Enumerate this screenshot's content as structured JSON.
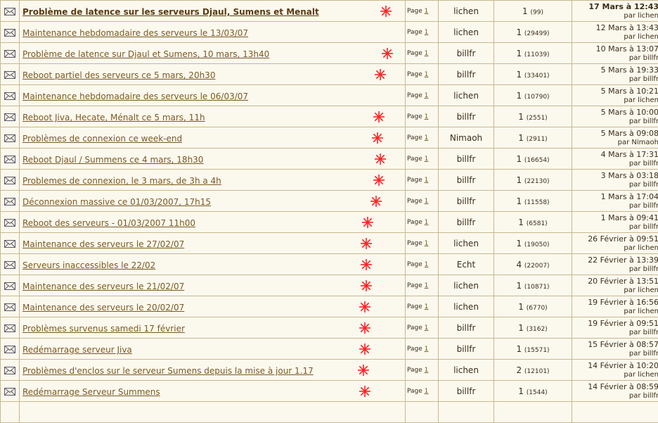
{
  "page_word": "Page",
  "topics": [
    {
      "title": "Problème de latence sur les serveurs Djaul, Sumens et Menalt",
      "page": "1",
      "author": "lichen",
      "replies": "1",
      "views": "(99)",
      "date": "17 Mars à 12:43",
      "by": "par lichen",
      "star": true
    },
    {
      "title": "Maintenance hebdomadaire des serveurs le 13/03/07",
      "page": "1",
      "author": "lichen",
      "replies": "1",
      "views": "(29499)",
      "date": "12 Mars à 13:43",
      "by": "par lichen",
      "star": false
    },
    {
      "title": "Problème de latence sur Djaul et Sumens, 10 mars, 13h40",
      "page": "1",
      "author": "billfr",
      "replies": "1",
      "views": "(11039)",
      "date": "10 Mars à 13:07",
      "by": "par billfr",
      "star": true
    },
    {
      "title": "Reboot partiel des serveurs ce 5 mars, 20h30",
      "page": "1",
      "author": "billfr",
      "replies": "1",
      "views": "(33401)",
      "date": "5 Mars à 19:33",
      "by": "par billfr",
      "star": true
    },
    {
      "title": "Maintenance hebdomadaire des serveurs le 06/03/07",
      "page": "1",
      "author": "lichen",
      "replies": "1",
      "views": "(10790)",
      "date": "5 Mars à 10:21",
      "by": "par lichen",
      "star": false
    },
    {
      "title": "Reboot Jiva, Hecate, Ménalt ce 5 mars, 11h",
      "page": "1",
      "author": "billfr",
      "replies": "1",
      "views": "(2551)",
      "date": "5 Mars à 10:00",
      "by": "par billfr",
      "star": true
    },
    {
      "title": "Problèmes de connexion ce week-end",
      "page": "1",
      "author": "Nimaoh",
      "replies": "1",
      "views": "(2911)",
      "date": "5 Mars à 09:08",
      "by": "par Nimaoh",
      "star": true
    },
    {
      "title": "Reboot Djaul / Summens ce 4 mars, 18h30",
      "page": "1",
      "author": "billfr",
      "replies": "1",
      "views": "(16654)",
      "date": "4 Mars à 17:31",
      "by": "par billfr",
      "star": true
    },
    {
      "title": "Problemes de connexion, le 3 mars, de 3h a 4h",
      "page": "1",
      "author": "billfr",
      "replies": "1",
      "views": "(22130)",
      "date": "3 Mars à 03:18",
      "by": "par billfr",
      "star": true
    },
    {
      "title": "Déconnexion massive ce 01/03/2007, 17h15",
      "page": "1",
      "author": "billfr",
      "replies": "1",
      "views": "(11558)",
      "date": "1 Mars à 17:04",
      "by": "par billfr",
      "star": true
    },
    {
      "title": "Reboot des serveurs - 01/03/2007 11h00",
      "page": "1",
      "author": "billfr",
      "replies": "1",
      "views": "(6581)",
      "date": "1 Mars à 09:41",
      "by": "par billfr",
      "star": true
    },
    {
      "title": "Maintenance des serveurs le 27/02/07",
      "page": "1",
      "author": "lichen",
      "replies": "1",
      "views": "(19050)",
      "date": "26 Février à 09:51",
      "by": "par lichen",
      "star": true
    },
    {
      "title": "Serveurs inaccessibles le 22/02",
      "page": "1",
      "author": "Echt",
      "replies": "4",
      "views": "(22007)",
      "date": "22 Février à 13:39",
      "by": "par billfr",
      "star": true
    },
    {
      "title": "Maintenance des serveurs le 21/02/07",
      "page": "1",
      "author": "lichen",
      "replies": "1",
      "views": "(10871)",
      "date": "20 Février à 13:51",
      "by": "par lichen",
      "star": true
    },
    {
      "title": "Maintenance des serveurs le 20/02/07",
      "page": "1",
      "author": "lichen",
      "replies": "1",
      "views": "(6770)",
      "date": "19 Février à 16:56",
      "by": "par lichen",
      "star": true
    },
    {
      "title": "Problèmes survenus samedi 17 février",
      "page": "1",
      "author": "billfr",
      "replies": "1",
      "views": "(3162)",
      "date": "19 Février à 09:51",
      "by": "par billfr",
      "star": true
    },
    {
      "title": "Redémarrage serveur Jiva",
      "page": "1",
      "author": "billfr",
      "replies": "1",
      "views": "(15571)",
      "date": "15 Février à 08:57",
      "by": "par billfr",
      "star": true
    },
    {
      "title": "Problèmes d'enclos sur le serveur Sumens depuis la mise à jour 1.17",
      "page": "1",
      "author": "lichen",
      "replies": "2",
      "views": "(12101)",
      "date": "14 Février à 10:20",
      "by": "par lichen",
      "star": true
    },
    {
      "title": "Redémarrage Serveur Summens",
      "page": "1",
      "author": "billfr",
      "replies": "1",
      "views": "(1544)",
      "date": "14 Février à 08:59",
      "by": "par billfr",
      "star": true
    }
  ],
  "colors": {
    "link": "#7a5a22",
    "star": "#ff2222",
    "border": "#c9b88e",
    "cell_bg": "#fbf8ee"
  }
}
